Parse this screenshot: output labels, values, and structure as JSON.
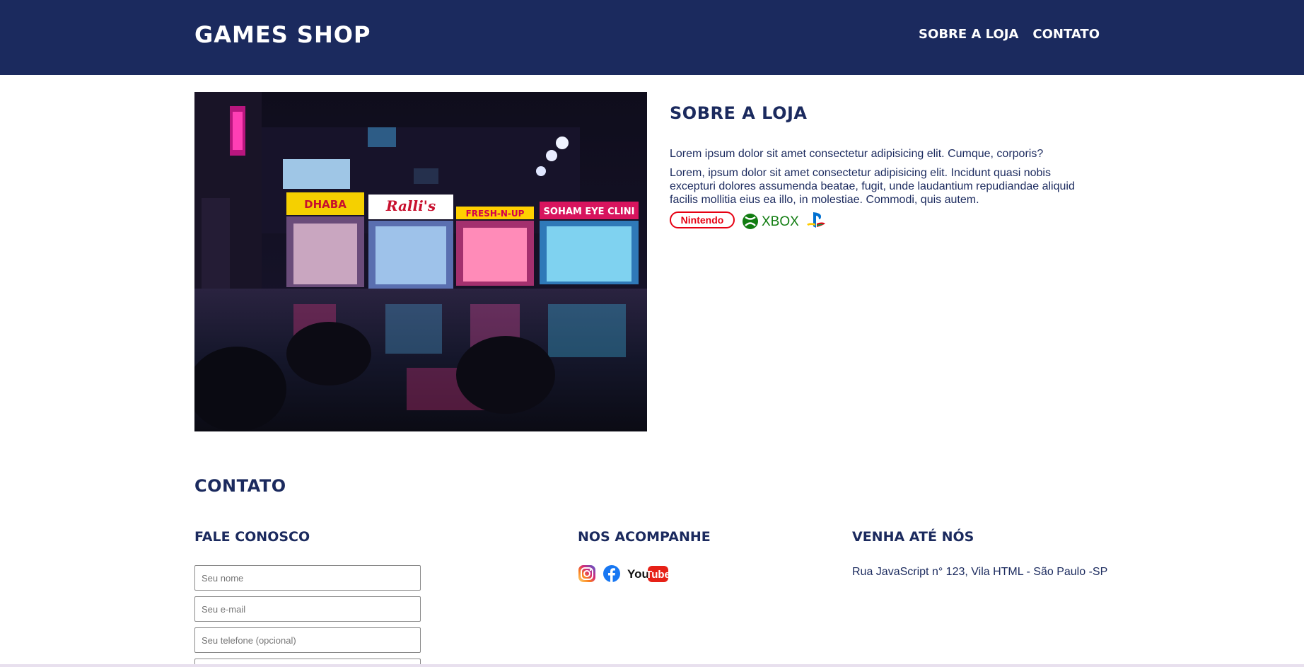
{
  "header": {
    "brand": "GAMES SHOP",
    "nav": [
      "SOBRE A LOJA",
      "CONTATO"
    ]
  },
  "about": {
    "title": "SOBRE A LOJA",
    "paragraph1": "Lorem ipsum dolor sit amet consectetur adipisicing elit. Cumque, corporis?",
    "paragraph2": "Lorem, ipsum dolor sit amet consectetur adipisicing elit. Incidunt quasi nobis excepturi dolores assumenda beatae, fugit, unde laudantium repudiandae aliquid facilis mollitia eius ea illo, in molestiae. Commodi, quis autem.",
    "brands": {
      "nintendo": "Nintendo",
      "xbox": "XBOX"
    }
  },
  "contact": {
    "title": "CONTATO",
    "form": {
      "title": "FALE CONOSCO",
      "name_placeholder": "Seu nome",
      "email_placeholder": "Seu e-mail",
      "phone_placeholder": "Seu telefone (opcional)"
    },
    "social": {
      "title": "NOS ACOMPANHE",
      "icons": [
        "instagram-icon",
        "facebook-icon",
        "youtube-icon"
      ],
      "youtube_you": "You",
      "youtube_tube": "Tube"
    },
    "location": {
      "title": "VENHA ATÉ NÓS",
      "address": "Rua JavaScript n° 123, Vila HTML - São Paulo -SP"
    }
  },
  "colors": {
    "primary": "#1b2a5e",
    "nintendo_red": "#e60012",
    "xbox_green": "#107c10",
    "facebook_blue": "#1877f2",
    "youtube_red": "#e62117"
  }
}
